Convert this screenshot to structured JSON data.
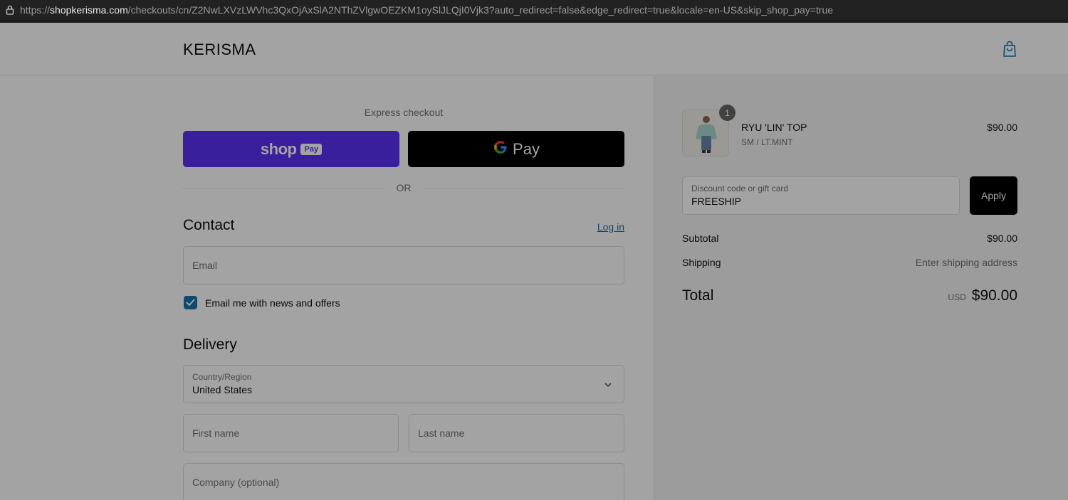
{
  "browser": {
    "url_prefix": "https://",
    "url_host": "shopkerisma.com",
    "url_path": "/checkouts/cn/Z2NwLXVzLWVhc3QxOjAxSlA2NThZVlgwOEZKM1oySlJLQjI0Vjk3?auto_redirect=false&edge_redirect=true&locale=en-US&skip_shop_pay=true"
  },
  "header": {
    "logo": "KERISMA",
    "cart_icon": "shopping-bag-icon"
  },
  "express": {
    "label": "Express checkout",
    "shop_pay_word": "shop",
    "shop_pay_pill": "Pay",
    "gpay_word": "Pay",
    "divider": "OR"
  },
  "contact": {
    "title": "Contact",
    "login_link": "Log in",
    "email_placeholder": "Email",
    "newsletter_label": "Email me with news and offers",
    "newsletter_checked": true
  },
  "delivery": {
    "title": "Delivery",
    "country_label": "Country/Region",
    "country_value": "United States",
    "first_name_placeholder": "First name",
    "last_name_placeholder": "Last name",
    "company_placeholder": "Company (optional)"
  },
  "order": {
    "item": {
      "quantity": "1",
      "name": "RYU 'LIN' TOP",
      "variant": "SM / LT.MINT",
      "price": "$90.00"
    },
    "discount_label": "Discount code or gift card",
    "discount_value": "FREESHIP",
    "apply_label": "Apply",
    "subtotal_label": "Subtotal",
    "subtotal_value": "$90.00",
    "shipping_label": "Shipping",
    "shipping_value": "Enter shipping address",
    "total_label": "Total",
    "currency": "USD",
    "total_value": "$90.00"
  },
  "colors": {
    "shop_pay": "#5a31f4",
    "link": "#1773b0",
    "checkbox": "#1773b0"
  }
}
